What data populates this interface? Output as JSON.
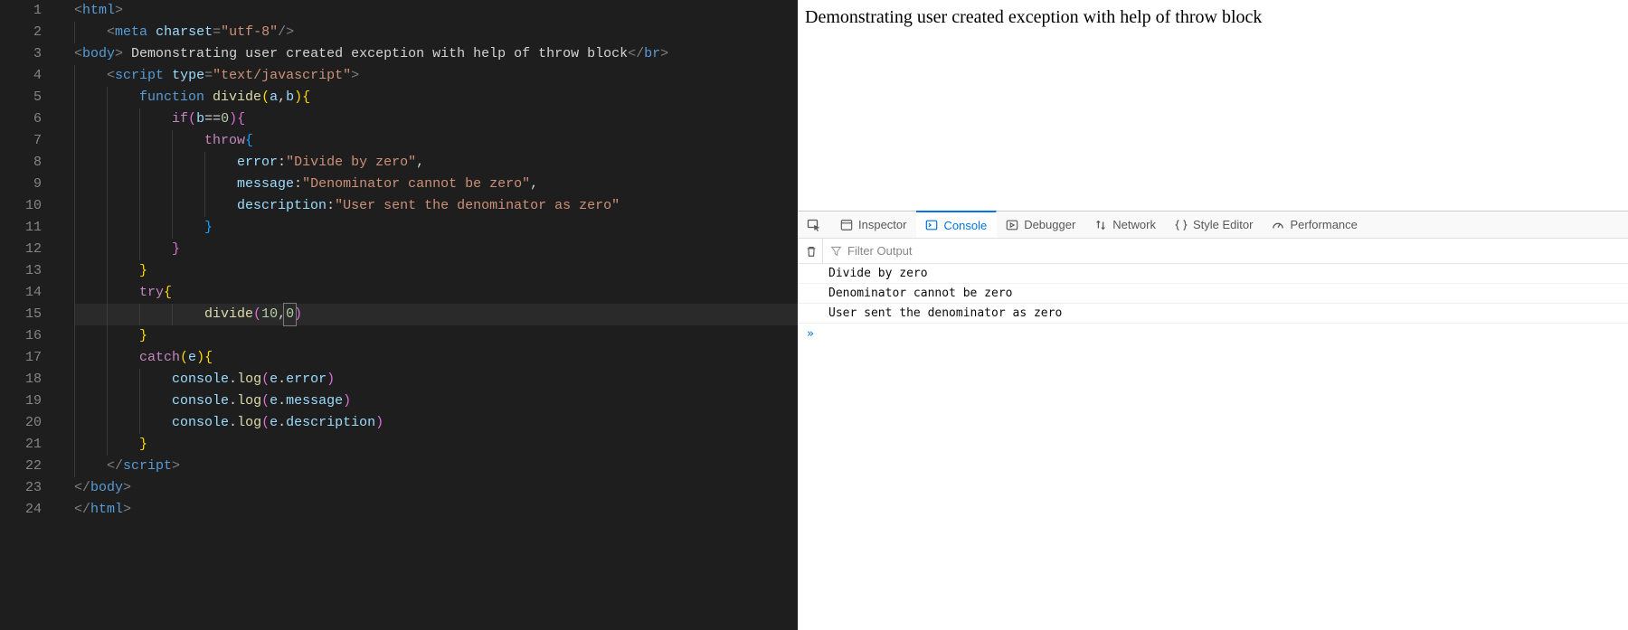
{
  "editor": {
    "line_count": 24,
    "current_line": 15,
    "tokens": [
      [
        {
          "c": "p",
          "t": "<"
        },
        {
          "c": "tag",
          "t": "html"
        },
        {
          "c": "p",
          "t": ">"
        }
      ],
      [
        {
          "c": "p",
          "t": "<"
        },
        {
          "c": "tag",
          "t": "meta"
        },
        {
          "c": "txt",
          "t": " "
        },
        {
          "c": "attr",
          "t": "charset"
        },
        {
          "c": "p",
          "t": "="
        },
        {
          "c": "str",
          "t": "\"utf-8\""
        },
        {
          "c": "p",
          "t": "/>"
        }
      ],
      [
        {
          "c": "p",
          "t": "<"
        },
        {
          "c": "tag",
          "t": "body"
        },
        {
          "c": "p",
          "t": ">"
        },
        {
          "c": "txt",
          "t": " Demonstrating user created exception with help of throw block"
        },
        {
          "c": "p",
          "t": "</"
        },
        {
          "c": "tag",
          "t": "br"
        },
        {
          "c": "p",
          "t": ">"
        }
      ],
      [
        {
          "c": "p",
          "t": "<"
        },
        {
          "c": "tag",
          "t": "script"
        },
        {
          "c": "txt",
          "t": " "
        },
        {
          "c": "attr",
          "t": "type"
        },
        {
          "c": "p",
          "t": "="
        },
        {
          "c": "str",
          "t": "\"text/javascript\""
        },
        {
          "c": "p",
          "t": ">"
        }
      ],
      [
        {
          "c": "fnkw",
          "t": "function"
        },
        {
          "c": "txt",
          "t": " "
        },
        {
          "c": "fn",
          "t": "divide"
        },
        {
          "c": "ylw",
          "t": "("
        },
        {
          "c": "id",
          "t": "a"
        },
        {
          "c": "txt",
          "t": ","
        },
        {
          "c": "id",
          "t": "b"
        },
        {
          "c": "ylw",
          "t": ")"
        },
        {
          "c": "ylw",
          "t": "{"
        }
      ],
      [
        {
          "c": "kw",
          "t": "if"
        },
        {
          "c": "pnk",
          "t": "("
        },
        {
          "c": "id",
          "t": "b"
        },
        {
          "c": "txt",
          "t": "=="
        },
        {
          "c": "num",
          "t": "0"
        },
        {
          "c": "pnk",
          "t": ")"
        },
        {
          "c": "pnk",
          "t": "{"
        }
      ],
      [
        {
          "c": "kw",
          "t": "throw"
        },
        {
          "c": "blu",
          "t": "{"
        }
      ],
      [
        {
          "c": "id",
          "t": "error"
        },
        {
          "c": "txt",
          "t": ":"
        },
        {
          "c": "str",
          "t": "\"Divide by zero\""
        },
        {
          "c": "txt",
          "t": ","
        }
      ],
      [
        {
          "c": "id",
          "t": "message"
        },
        {
          "c": "txt",
          "t": ":"
        },
        {
          "c": "str",
          "t": "\"Denominator cannot be zero\""
        },
        {
          "c": "txt",
          "t": ","
        }
      ],
      [
        {
          "c": "id",
          "t": "description"
        },
        {
          "c": "txt",
          "t": ":"
        },
        {
          "c": "str",
          "t": "\"User sent the denominator as zero\""
        }
      ],
      [
        {
          "c": "blu",
          "t": "}"
        }
      ],
      [
        {
          "c": "pnk",
          "t": "}"
        }
      ],
      [
        {
          "c": "ylw",
          "t": "}"
        }
      ],
      [
        {
          "c": "kw",
          "t": "try"
        },
        {
          "c": "ylw",
          "t": "{"
        }
      ],
      [
        {
          "c": "fn",
          "t": "divide"
        },
        {
          "c": "pnk",
          "t": "("
        },
        {
          "c": "num",
          "t": "10"
        },
        {
          "c": "txt",
          "t": ","
        },
        {
          "c": "num",
          "t": "0",
          "box": true
        },
        {
          "c": "pnk",
          "t": ")"
        }
      ],
      [
        {
          "c": "ylw",
          "t": "}"
        }
      ],
      [
        {
          "c": "kw",
          "t": "catch"
        },
        {
          "c": "ylw",
          "t": "("
        },
        {
          "c": "id",
          "t": "e"
        },
        {
          "c": "ylw",
          "t": ")"
        },
        {
          "c": "ylw",
          "t": "{"
        }
      ],
      [
        {
          "c": "id",
          "t": "console"
        },
        {
          "c": "txt",
          "t": "."
        },
        {
          "c": "fn",
          "t": "log"
        },
        {
          "c": "pnk",
          "t": "("
        },
        {
          "c": "id",
          "t": "e"
        },
        {
          "c": "txt",
          "t": "."
        },
        {
          "c": "id",
          "t": "error"
        },
        {
          "c": "pnk",
          "t": ")"
        }
      ],
      [
        {
          "c": "id",
          "t": "console"
        },
        {
          "c": "txt",
          "t": "."
        },
        {
          "c": "fn",
          "t": "log"
        },
        {
          "c": "pnk",
          "t": "("
        },
        {
          "c": "id",
          "t": "e"
        },
        {
          "c": "txt",
          "t": "."
        },
        {
          "c": "id",
          "t": "message"
        },
        {
          "c": "pnk",
          "t": ")"
        }
      ],
      [
        {
          "c": "id",
          "t": "console"
        },
        {
          "c": "txt",
          "t": "."
        },
        {
          "c": "fn",
          "t": "log"
        },
        {
          "c": "pnk",
          "t": "("
        },
        {
          "c": "id",
          "t": "e"
        },
        {
          "c": "txt",
          "t": "."
        },
        {
          "c": "id",
          "t": "description"
        },
        {
          "c": "pnk",
          "t": ")"
        }
      ],
      [
        {
          "c": "ylw",
          "t": "}"
        }
      ],
      [
        {
          "c": "p",
          "t": "</"
        },
        {
          "c": "tag",
          "t": "script"
        },
        {
          "c": "p",
          "t": ">"
        }
      ],
      [
        {
          "c": "p",
          "t": "</"
        },
        {
          "c": "tag",
          "t": "body"
        },
        {
          "c": "p",
          "t": ">"
        }
      ],
      [
        {
          "c": "p",
          "t": "</"
        },
        {
          "c": "tag",
          "t": "html"
        },
        {
          "c": "p",
          "t": ">"
        }
      ]
    ],
    "indents": [
      0,
      1,
      0,
      1,
      2,
      3,
      4,
      5,
      5,
      5,
      4,
      3,
      2,
      2,
      4,
      2,
      2,
      3,
      3,
      3,
      2,
      1,
      0,
      0
    ]
  },
  "preview": {
    "body_text": "Demonstrating user created exception with help of throw block"
  },
  "devtools": {
    "tabs": {
      "inspector": "Inspector",
      "console": "Console",
      "debugger": "Debugger",
      "network": "Network",
      "style": "Style Editor",
      "perf": "Performance"
    },
    "active_tab": "console",
    "filter_placeholder": "Filter Output",
    "log": [
      "Divide by zero",
      "Denominator cannot be zero",
      "User sent the denominator as zero"
    ],
    "prompt": "»"
  }
}
